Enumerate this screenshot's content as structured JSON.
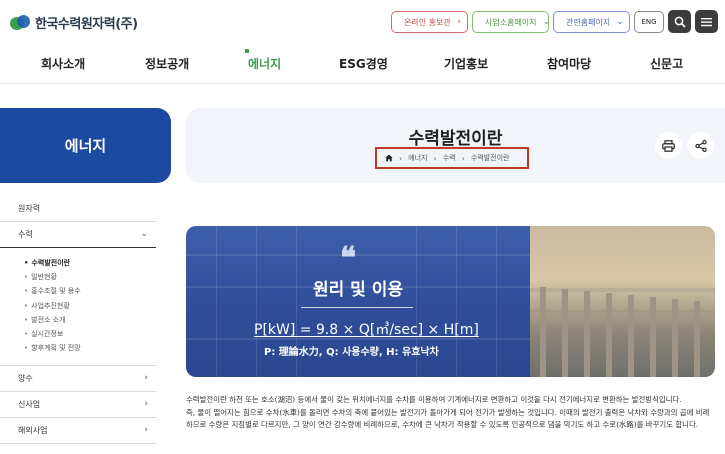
{
  "header": {
    "logo_text": "한국수력원자력(주)",
    "links": [
      {
        "label": "온라인 홍보관",
        "color": "#c94b4b"
      },
      {
        "label": "사업소홈페이지",
        "color": "#4f9a3f"
      },
      {
        "label": "관련홈페이지",
        "color": "#4e6ab0"
      }
    ],
    "lang_button": "ENG",
    "search_icon": "search-icon",
    "menu_icon": "hamburger-menu-icon"
  },
  "nav": {
    "items": [
      "회사소개",
      "정보공개",
      "에너지",
      "ESG경영",
      "기업홍보",
      "참여마당",
      "신문고"
    ],
    "active": "에너지",
    "accent_color": "#3d9b4c"
  },
  "sidebar": {
    "title": "에너지",
    "title_bg": "#1d4aa1",
    "items": [
      {
        "label": "원자력",
        "expanded": false
      },
      {
        "label": "수력",
        "expanded": true
      },
      {
        "label": "양수",
        "expanded": false
      },
      {
        "label": "신사업",
        "expanded": false
      },
      {
        "label": "해외사업",
        "expanded": false
      }
    ],
    "sub_items": [
      "수력발전이란",
      "일반현황",
      "홍수조절 및 용수",
      "사업추진현황",
      "발전소 소개",
      "실시간정보",
      "향후계획 및 전망"
    ],
    "sub_active": "수력발전이란"
  },
  "page": {
    "title": "수력발전이란",
    "breadcrumb": [
      "에너지",
      "수력",
      "수력발전이란"
    ],
    "home_icon": "home-icon",
    "print_icon": "print-icon",
    "share_icon": "share-icon"
  },
  "hero": {
    "quote_mark": "❝",
    "heading": "원리 및 이용",
    "formula": "P[kW] = 9.8 × Q[㎥/sec] × H[m]",
    "note": "P: 理論水力, Q: 사용수량, H: 유효낙차"
  },
  "body": {
    "paragraphs": [
      "수력발전이란 하천 또는 호소(湖沼) 등에서 물이 갖는 위치에너지를 수차를 이용하여 기계에너지로 변환하고 이것을 다시 전기에너지로 변환하는 발전방식입니다.",
      "즉, 물이 떨어지는 힘으로 수차(水車)를 돌리면 수차의 축에 붙어있는 발전기가 돌아가게 되어 전기가 발생하는 것입니다. 이때의 발전기 출력은 낙차와 수량과의 곱에 비례하므로 수량은 지점별로 다르지만, 그 양이 연간 강수량에 비례하므로, 수차에 큰 낙차가 작용할 수 있도록 인공적으로 댐을 막기도 하고 수로(水路)를 바꾸기도 합니다."
    ]
  }
}
